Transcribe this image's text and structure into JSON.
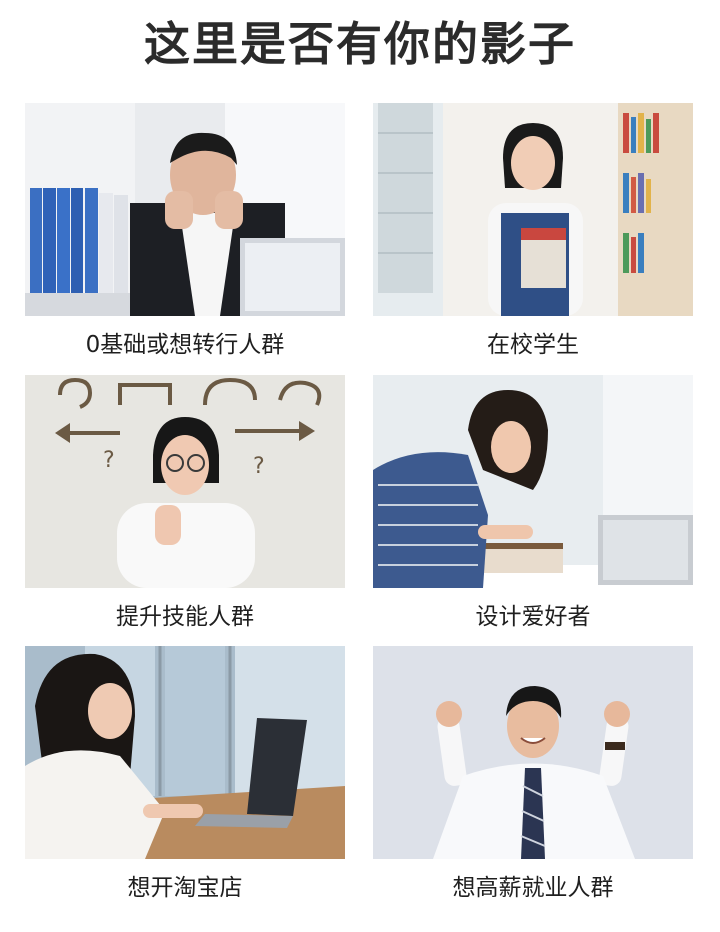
{
  "header": {
    "title": "这里是否有你的影子"
  },
  "groups": [
    {
      "caption": "0基础或想转行人群",
      "photo_icon": "stressed-office-man"
    },
    {
      "caption": "在校学生",
      "photo_icon": "student-with-book"
    },
    {
      "caption": "提升技能人群",
      "photo_icon": "thinking-woman"
    },
    {
      "caption": "设计爱好者",
      "photo_icon": "woman-writing"
    },
    {
      "caption": "想开淘宝店",
      "photo_icon": "woman-at-laptop"
    },
    {
      "caption": "想高薪就业人群",
      "photo_icon": "cheering-man"
    }
  ],
  "colors": {
    "title": "#2b2b2b",
    "caption": "#1f1f1f",
    "background": "#ffffff"
  }
}
